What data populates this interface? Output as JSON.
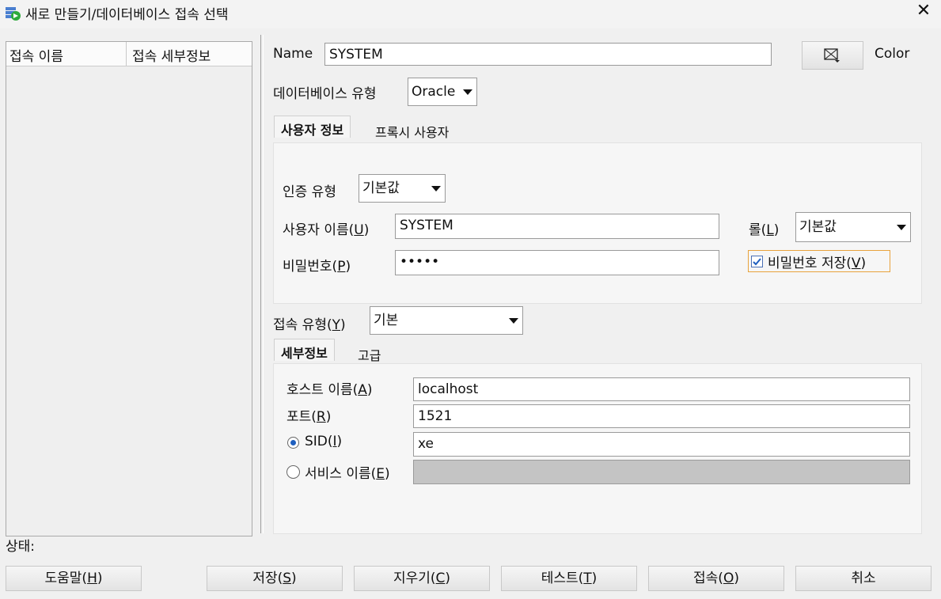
{
  "window": {
    "title": "새로 만들기/데이터베이스 접속 선택",
    "close_glyph": "✕",
    "app_icon": "database-new-icon"
  },
  "connection_list": {
    "columns": [
      "접속 이름",
      "접속 세부정보"
    ]
  },
  "form": {
    "name_label": "Name",
    "name_value": "SYSTEM",
    "color_label": "Color",
    "db_type_label": "데이터베이스 유형",
    "db_type_value": "Oracle",
    "tabs": [
      "사용자 정보",
      "프록시 사용자"
    ],
    "auth_type_label": "인증 유형",
    "auth_type_value": "기본값",
    "username_label_pre": "사용자 이름(",
    "username_label_key": "U",
    "username_label_post": ")",
    "username_value": "SYSTEM",
    "role_label_pre": "롤(",
    "role_label_key": "L",
    "role_label_post": ")",
    "role_value": "기본값",
    "password_label_pre": "비밀번호(",
    "password_label_key": "P",
    "password_label_post": ")",
    "password_value": "•••••",
    "save_password_pre": "비밀번호 저장(",
    "save_password_key": "V",
    "save_password_post": ")",
    "save_password_checked": true,
    "conn_type_label_pre": "접속 유형(",
    "conn_type_label_key": "Y",
    "conn_type_label_post": ")",
    "conn_type_value": "기본",
    "detail_tabs": [
      "세부정보",
      "고급"
    ],
    "host_label_pre": "호스트 이름(",
    "host_label_key": "A",
    "host_label_post": ")",
    "host_value": "localhost",
    "port_label_pre": "포트(",
    "port_label_key": "R",
    "port_label_post": ")",
    "port_value": "1521",
    "sid_label_pre": "SID(",
    "sid_label_key": "I",
    "sid_label_post": ")",
    "sid_value": "xe",
    "service_label_pre": "서비스 이름(",
    "service_label_key": "E",
    "service_label_post": ")",
    "service_value": ""
  },
  "status_label": "상태:",
  "buttons": {
    "help_pre": "도움말(",
    "help_key": "H",
    "help_post": ")",
    "save_pre": "저장(",
    "save_key": "S",
    "save_post": ")",
    "clear_pre": "지우기(",
    "clear_key": "C",
    "clear_post": ")",
    "test_pre": "테스트(",
    "test_key": "T",
    "test_post": ")",
    "connect_pre": "접속(",
    "connect_key": "O",
    "connect_post": ")",
    "cancel": "취소"
  },
  "colors": {
    "focus_border": "#e8a33d",
    "disabled_field": "#c4c4c4",
    "checkbox_check": "#1f5fbf"
  }
}
